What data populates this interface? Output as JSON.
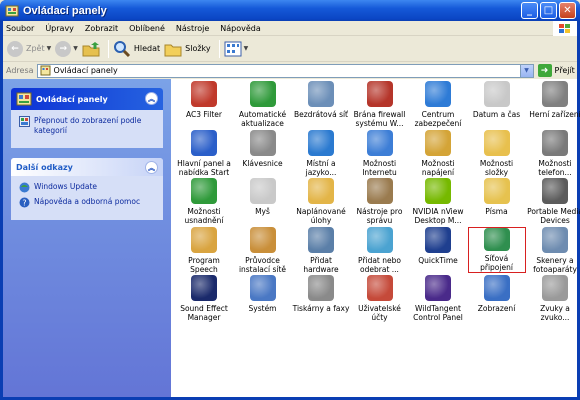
{
  "window": {
    "title": "Ovládací panely",
    "buttons": {
      "minimize": "_",
      "maximize": "□",
      "close": "✕"
    }
  },
  "menu": [
    "Soubor",
    "Úpravy",
    "Zobrazit",
    "Oblíbené",
    "Nástroje",
    "Nápověda"
  ],
  "toolbar": {
    "back": "Zpět",
    "search": "Hledat",
    "folders": "Složky"
  },
  "address": {
    "label": "Adresa",
    "value": "Ovládací panely",
    "go": "Přejít"
  },
  "leftpane": {
    "panel_title": "Ovládací panely",
    "switch_link": "Přepnout do zobrazení podle kategorií",
    "see_also_title": "Další odkazy",
    "see_also": [
      "Windows Update",
      "Nápověda a odborná pomoc"
    ]
  },
  "items": [
    {
      "label": "AC3 Filter",
      "icon": "ac3-filter-icon",
      "color": "#c0392b"
    },
    {
      "label": "Automatické aktualizace",
      "icon": "auto-update-icon",
      "color": "#2f9a3a"
    },
    {
      "label": "Bezdrátová síť",
      "icon": "wireless-network-icon",
      "color": "#6c8fb8"
    },
    {
      "label": "Brána firewall systému W...",
      "icon": "firewall-icon",
      "color": "#b5352a"
    },
    {
      "label": "Centrum zabezpečení",
      "icon": "security-center-icon",
      "color": "#2e7bd6"
    },
    {
      "label": "Datum a čas",
      "icon": "date-time-icon",
      "color": "#c8c8c8"
    },
    {
      "label": "Herní zařízení",
      "icon": "game-controller-icon",
      "color": "#808080"
    },
    {
      "label": "Hlavní panel a nabídka Start",
      "icon": "taskbar-icon",
      "color": "#2b5fc9"
    },
    {
      "label": "Klávesnice",
      "icon": "keyboard-icon",
      "color": "#8a8a8a"
    },
    {
      "label": "Místní a jazyko...",
      "icon": "regional-icon",
      "color": "#2b7ad0"
    },
    {
      "label": "Možnosti Internetu",
      "icon": "internet-options-icon",
      "color": "#3d7ed6"
    },
    {
      "label": "Možnosti napájení",
      "icon": "power-options-icon",
      "color": "#d4a437"
    },
    {
      "label": "Možnosti složky",
      "icon": "folder-options-icon",
      "color": "#e8c04e"
    },
    {
      "label": "Možnosti telefon...",
      "icon": "phone-modem-icon",
      "color": "#7a7a7a"
    },
    {
      "label": "Možnosti usnadnění",
      "icon": "accessibility-icon",
      "color": "#2f9a3a"
    },
    {
      "label": "Myš",
      "icon": "mouse-icon",
      "color": "#c9c9c9"
    },
    {
      "label": "Naplánované úlohy",
      "icon": "scheduled-tasks-icon",
      "color": "#e3b548"
    },
    {
      "label": "Nástroje pro správu",
      "icon": "admin-tools-icon",
      "color": "#9a7b4f"
    },
    {
      "label": "NVIDIA nView Desktop M...",
      "icon": "nvidia-icon",
      "color": "#76b900"
    },
    {
      "label": "Písma",
      "icon": "fonts-icon",
      "color": "#e6c24f"
    },
    {
      "label": "Portable Media Devices",
      "icon": "media-devices-icon",
      "color": "#5c5c5c"
    },
    {
      "label": "Program Speech",
      "icon": "speech-icon",
      "color": "#d9a440"
    },
    {
      "label": "Průvodce instalací sítě",
      "icon": "network-setup-icon",
      "color": "#c98f3a"
    },
    {
      "label": "Přidat hardware",
      "icon": "add-hardware-icon",
      "color": "#5b7fa8"
    },
    {
      "label": "Přidat nebo odebrat ...",
      "icon": "add-remove-programs-icon",
      "color": "#4ba3d1"
    },
    {
      "label": "QuickTime",
      "icon": "quicktime-icon",
      "color": "#1f3f8f"
    },
    {
      "label": "Síťová připojení",
      "icon": "network-connections-icon",
      "color": "#2f8f4f"
    },
    {
      "label": "Skenery a fotoaparáty",
      "icon": "scanner-camera-icon",
      "color": "#6e8cb0"
    },
    {
      "label": "Sound Effect Manager",
      "icon": "sound-effect-icon",
      "color": "#1a2a6b"
    },
    {
      "label": "Systém",
      "icon": "system-icon",
      "color": "#4a78c4"
    },
    {
      "label": "Tiskárny a faxy",
      "icon": "printer-icon",
      "color": "#8a8a8a"
    },
    {
      "label": "Uživatelské účty",
      "icon": "user-accounts-icon",
      "color": "#c54a3a"
    },
    {
      "label": "WildTangent Control Panel",
      "icon": "wildtangent-icon",
      "color": "#4a2a8a"
    },
    {
      "label": "Zobrazení",
      "icon": "display-icon",
      "color": "#3a6fc4"
    },
    {
      "label": "Zvuky a zvuko...",
      "icon": "sounds-icon",
      "color": "#9a9a9a"
    }
  ],
  "selected_item": "Síťová připojení"
}
